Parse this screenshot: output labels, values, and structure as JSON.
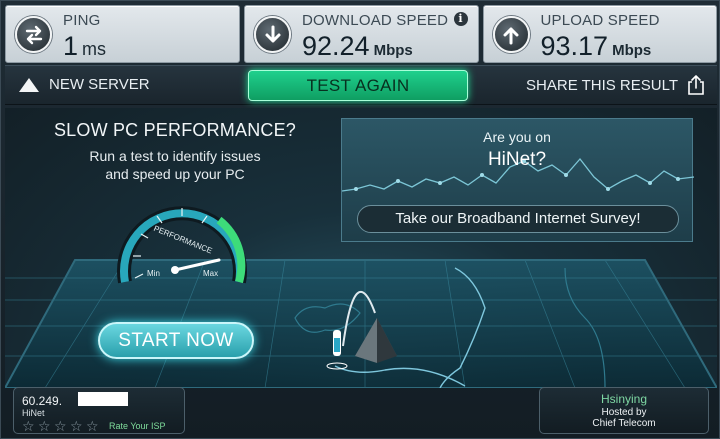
{
  "stats": {
    "ping": {
      "label": "PING",
      "value": "1",
      "unit": "ms"
    },
    "download": {
      "label": "DOWNLOAD SPEED",
      "value": "92.24",
      "unit": "Mbps"
    },
    "upload": {
      "label": "UPLOAD SPEED",
      "value": "93.17",
      "unit": "Mbps"
    }
  },
  "actions": {
    "new_server": "NEW SERVER",
    "test_again": "TEST AGAIN",
    "share": "SHARE THIS RESULT"
  },
  "promo": {
    "title": "SLOW PC PERFORMANCE?",
    "line1": "Run a test to identify issues",
    "line2": "and speed up your PC",
    "gauge_label": "PERFORMANCE",
    "min": "Min",
    "max": "Max",
    "start": "START NOW"
  },
  "survey": {
    "question": "Are you on",
    "isp": "HiNet?",
    "button": "Take our Broadband Internet Survey!"
  },
  "isp": {
    "ip": "60.249.",
    "name": "HiNet",
    "rate": "Rate Your ISP",
    "stars_total": 5,
    "stars_filled": 0
  },
  "server": {
    "city": "Hsinying",
    "hosted_label": "Hosted by",
    "host": "Chief Telecom"
  },
  "colors": {
    "accent_green": "#1fd08d",
    "accent_cyan": "#3ad4e2",
    "stat_panel": "#d6dde2"
  },
  "icons": {
    "ping": "ping-arrows-icon",
    "download": "download-arrow-icon",
    "upload": "upload-arrow-icon",
    "info": "info-icon",
    "new_server": "triangle-up-icon",
    "share": "share-icon"
  }
}
